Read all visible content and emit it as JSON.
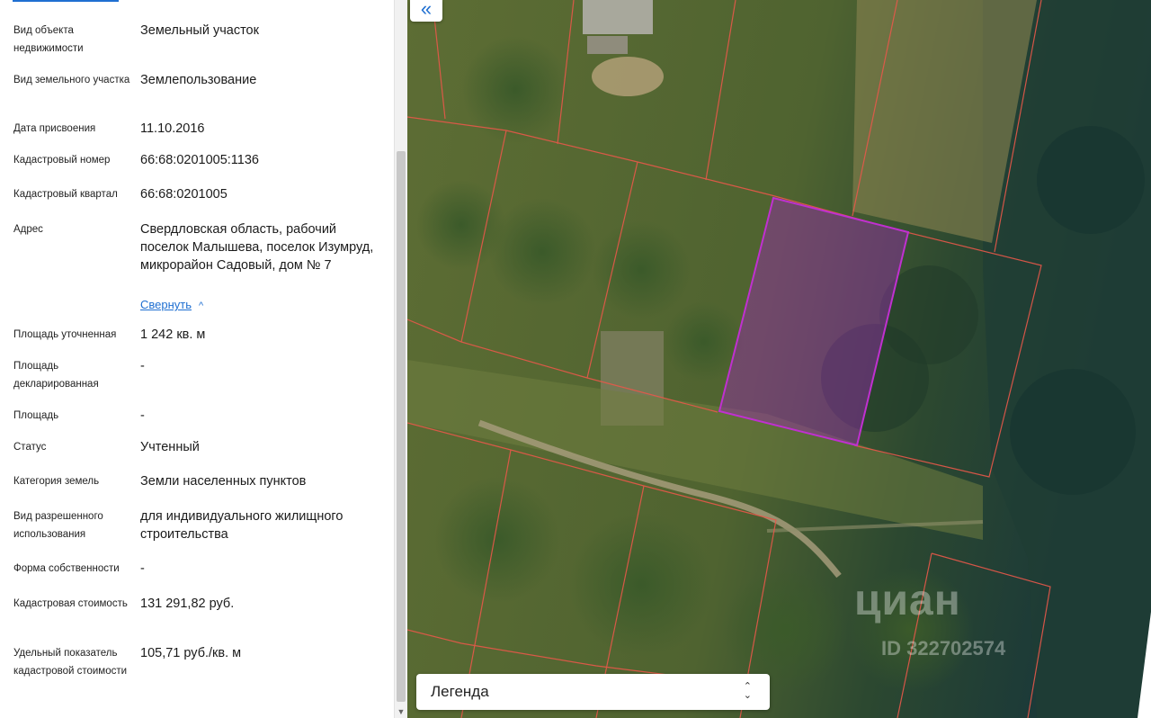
{
  "panel": {
    "rows": [
      {
        "label": "Вид объекта недвижимости",
        "value": "Земельный участок"
      },
      {
        "label": "Вид земельного участка",
        "value": "Землепользование"
      },
      {
        "label": "Дата присвоения",
        "value": "11.10.2016"
      },
      {
        "label": "Кадастровый номер",
        "value": "66:68:0201005:1136"
      },
      {
        "label": "Кадастровый квартал",
        "value": "66:68:0201005"
      },
      {
        "label": "Адрес",
        "value": "Свердловская область, рабочий поселок Малышева, поселок Изумруд, микрорайон Садовый, дом № 7"
      },
      {
        "label": "Площадь уточненная",
        "value": "1 242 кв. м"
      },
      {
        "label": "Площадь декларированная",
        "value": "-"
      },
      {
        "label": "Площадь",
        "value": "-"
      },
      {
        "label": "Статус",
        "value": "Учтенный"
      },
      {
        "label": "Категория земель",
        "value": "Земли населенных пунктов"
      },
      {
        "label": "Вид разрешенного использования",
        "value": "для индивидуального жилищного строительства"
      },
      {
        "label": "Форма собственности",
        "value": "-"
      },
      {
        "label": "Кадастровая стоимость",
        "value": "131 291,82 руб."
      },
      {
        "label": "Удельный показатель кадастровой стоимости",
        "value": "105,71 руб./кв. м"
      }
    ],
    "collapse_link": "Свернуть"
  },
  "map": {
    "collapse_button_icon": "double-chevron-left-icon",
    "legend_label": "Легенда",
    "legend_toggle_icon": "chevron-up-down-icon",
    "watermark_brand": "циан",
    "watermark_id": "ID 322702574",
    "colors": {
      "parcel_border": "#e8584a",
      "selected_parcel": "#b030c0",
      "link": "#1f6fd1"
    }
  }
}
